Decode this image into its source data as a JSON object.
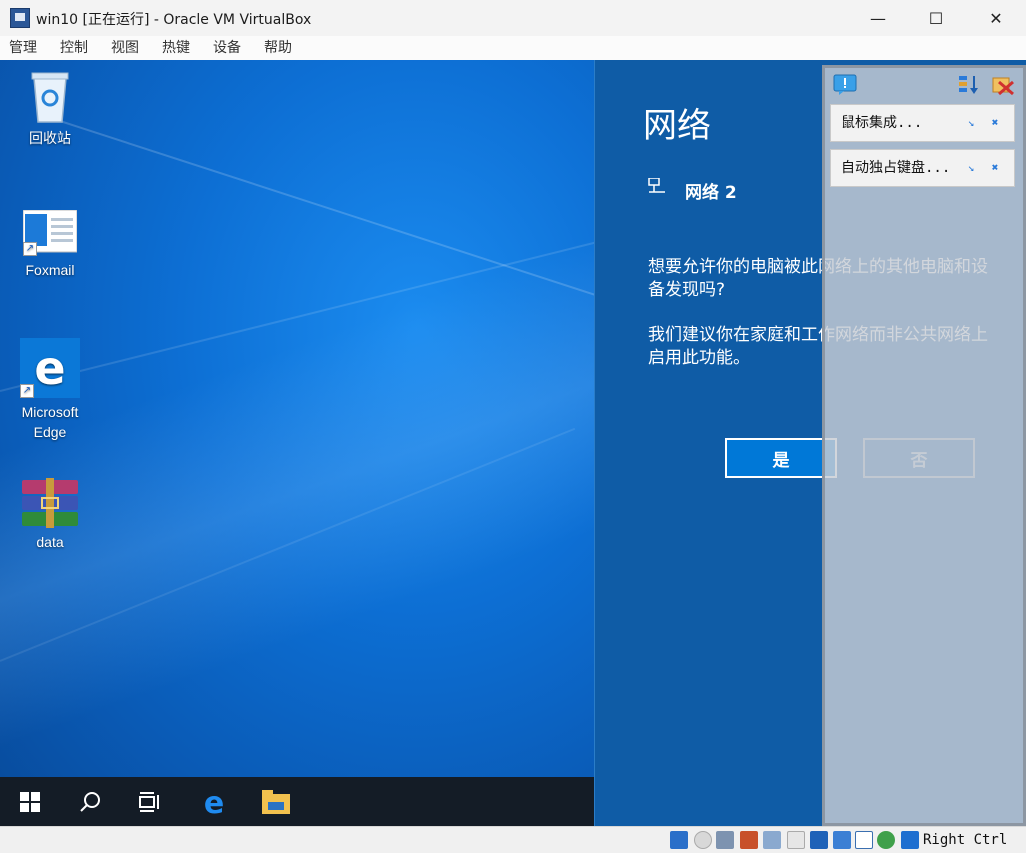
{
  "window": {
    "title": "win10 [正在运行] - Oracle VM VirtualBox",
    "minimize_glyph": "—",
    "maximize_glyph": "☐",
    "close_glyph": "✕"
  },
  "menu": {
    "items": [
      {
        "label": "管理"
      },
      {
        "label": "控制"
      },
      {
        "label": "视图"
      },
      {
        "label": "热键"
      },
      {
        "label": "设备"
      },
      {
        "label": "帮助"
      }
    ]
  },
  "desktop": {
    "icons": [
      {
        "label": "回收站",
        "icon": "recycle-bin-icon"
      },
      {
        "label": "Foxmail",
        "icon": "foxmail-icon"
      },
      {
        "label": "Microsoft Edge",
        "icon": "edge-icon"
      },
      {
        "label": "data",
        "icon": "winrar-icon"
      }
    ]
  },
  "taskbar": {
    "items": [
      "start-icon",
      "search-icon",
      "task-view-icon",
      "edge-icon",
      "file-explorer-icon"
    ]
  },
  "network": {
    "title": "网络",
    "network_name": "网络 2",
    "question": "想要允许你的电脑被此网络上的其他电脑和设备发现吗?",
    "recommendation": "我们建议你在家庭和工作网络而非公共网络上启用此功能。",
    "yes_label": "是",
    "no_label": "否"
  },
  "notifications": {
    "items": [
      {
        "label": "鼠标集成..."
      },
      {
        "label": "自动独占键盘..."
      }
    ]
  },
  "statusbar": {
    "host_key": "Right Ctrl",
    "icons": [
      "hard-disk-icon",
      "optical-drive-icon",
      "audio-icon",
      "network-icon",
      "usb-icon",
      "shared-folders-icon",
      "display-icon",
      "recording-icon",
      "vtx-icon",
      "guest-additions-icon",
      "mouse-integration-icon"
    ]
  },
  "colors": {
    "accent": "#0078d7",
    "network_pane": "#0f5ca6",
    "taskbar": "#141c26"
  }
}
